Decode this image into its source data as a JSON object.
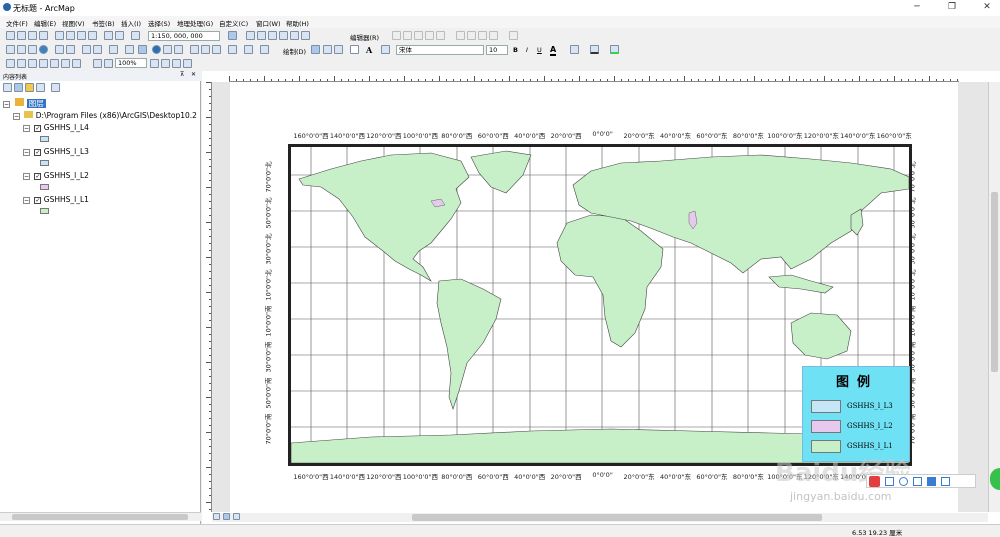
{
  "window": {
    "title": "无标题 - ArcMap"
  },
  "menu": [
    "文件(F)",
    "编辑(E)",
    "视图(V)",
    "书签(B)",
    "插入(I)",
    "选择(S)",
    "地理处理(G)",
    "自定义(C)",
    "窗口(W)",
    "帮助(H)"
  ],
  "toolbar": {
    "scale": "1:150, 000, 000",
    "editor_label": "编辑器(R)",
    "draw_label": "绘制(D)",
    "font_name": "宋体",
    "font_size": "10",
    "zoom": "100%",
    "bold": "B",
    "italic": "I",
    "underline": "U"
  },
  "toc": {
    "title": "内容列表",
    "root": "图层",
    "path": "D:\\Program Files (x86)\\ArcGIS\\Desktop10.2",
    "layers": [
      {
        "name": "GSHHS_l_L4",
        "color": "#c6e5f6"
      },
      {
        "name": "GSHHS_l_L3",
        "color": "#c6e5f6"
      },
      {
        "name": "GSHHS_l_L2",
        "color": "#e7c9f0"
      },
      {
        "name": "GSHHS_l_L1",
        "color": "#c8f0c8"
      }
    ]
  },
  "map": {
    "top_labels": [
      "160°0'0\"西",
      "140°0'0\"西",
      "120°0'0\"西",
      "100°0'0\"西",
      "80°0'0\"西",
      "60°0'0\"西",
      "40°0'0\"西",
      "20°0'0\"西",
      "0°0'0\"",
      "20°0'0\"东",
      "40°0'0\"东",
      "60°0'0\"东",
      "80°0'0\"东",
      "100°0'0\"东",
      "120°0'0\"东",
      "140°0'0\"东",
      "160°0'0\"东"
    ],
    "bottom_labels": [
      "160°0'0\"西",
      "140°0'0\"西",
      "120°0'0\"西",
      "100°0'0\"西",
      "80°0'0\"西",
      "60°0'0\"西",
      "40°0'0\"西",
      "20°0'0\"西",
      "0°0'0\"",
      "20°0'0\"东",
      "40°0'0\"东",
      "60°0'0\"东",
      "80°0'0\"东",
      "100°0'0\"东",
      "120°0'0\"东",
      "140°0'0\"东"
    ],
    "left_labels": [
      "70°0'0\"北",
      "50°0'0\"北",
      "30°0'0\"北",
      "10°0'0\"北",
      "10°0'0\"南",
      "30°0'0\"南",
      "50°0'0\"南",
      "70°0'0\"南"
    ],
    "right_labels": [
      "70°0'0\"北",
      "50°0'0\"北",
      "30°0'0\"北",
      "10°0'0\"北",
      "10°0'0\"南",
      "30°0'0\"南",
      "50°0'0\"南",
      "70°0'0\"南"
    ],
    "land_color": "#c8f0c8",
    "lake_color": "#e7c9f0"
  },
  "legend": {
    "title": "图例",
    "items": [
      {
        "label": "GSHHS_l_L3",
        "color": "#c6e5f6"
      },
      {
        "label": "GSHHS_l_L2",
        "color": "#e7c9f0"
      },
      {
        "label": "GSHHS_l_L1",
        "color": "#c8f0c8"
      }
    ]
  },
  "status": {
    "coords": "6.53  19.23 厘米"
  },
  "watermark": {
    "brand": "Baidu经验",
    "url": "jingyan.baidu.com"
  }
}
